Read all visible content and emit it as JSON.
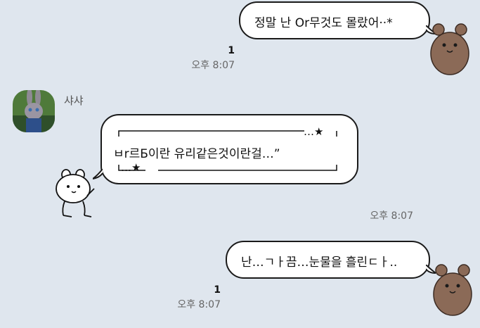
{
  "messages": [
    {
      "text": "정말 난 Or무것도 몰랐어··*",
      "unread": "1",
      "time": "오후 8:07"
    },
    {
      "sender": "샤샤",
      "frame_top_end": "…★",
      "text": "ㅂr르Б이란 유리같은것이란걸…”",
      "frame_bottom_start": "…★",
      "time": "오후 8:07"
    },
    {
      "text": "난…ㄱㅏ끔…눈물을 흘린ㄷㅏ..",
      "unread": "1",
      "time": "오후 8:07"
    }
  ],
  "colors": {
    "background": "#dfe6ee",
    "bubble_fill": "#ffffff",
    "bubble_border": "#1a1a1a",
    "bear": "#8b6a57",
    "time_text": "#666666"
  },
  "icons": {
    "bear_sticker": "brown-bear-sticker-icon",
    "rabbit_sticker": "white-rabbit-sticker-icon",
    "avatar": "bunny-avatar-image"
  }
}
